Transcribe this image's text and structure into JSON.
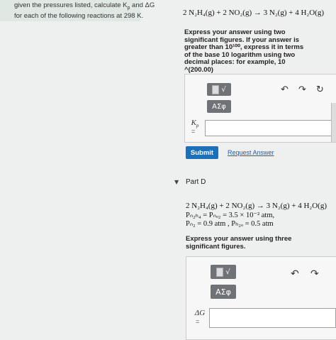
{
  "intro": {
    "line1": "given the pressures listed, calculate K",
    "line1_sub": "p",
    "line1_tail": " and ΔG",
    "line2": "for each of the following reactions at 298 K."
  },
  "partC": {
    "equation": "2 N₂H₄(g) + 2 NO₂(g) → 3 N₂(g) + 4 H₂O(g)",
    "instructions": [
      "Express your answer using two",
      "significant figures. If your answer is",
      "greater than 10¹⁰⁰, express it in terms",
      "of the base 10 logarithm using two",
      "decimal places: for example, 10",
      "^(200.00)"
    ],
    "variable": "K",
    "variable_sub": "p",
    "equals": "=",
    "tool_greek": "AΣφ",
    "undo_icon": "↶",
    "redo_icon": "↷",
    "reset_icon": "↻",
    "submit_label": "Submit",
    "request_answer_label": "Request Answer"
  },
  "partD": {
    "caret": "▼",
    "title": "Part D",
    "equation": "2 N₂H₄(g) + 2 NO₂(g) → 3 N₂(g) + 4 H₂O(g)",
    "pressure_line1": "Pₙ₂ₕ₄ = Pₙₒ₂ = 3.5 × 10⁻² atm,",
    "pressure_line2": "Pₙ₂ = 0.9 atm , Pₕ₂ₒ = 0.5 atm",
    "instructions": [
      "Express your answer using three",
      "significant figures."
    ],
    "variable": "ΔG",
    "equals": "=",
    "tool_greek": "AΣφ",
    "undo_icon": "↶",
    "redo_icon": "↷"
  }
}
